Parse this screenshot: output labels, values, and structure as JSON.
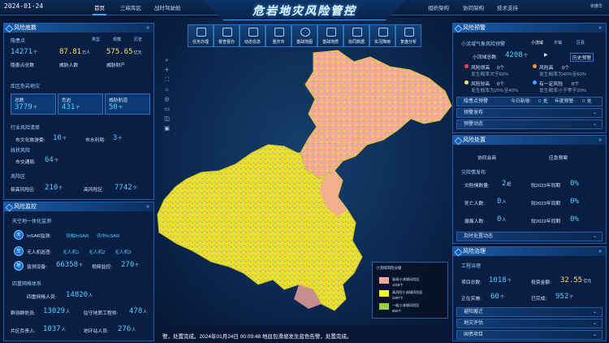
{
  "header": {
    "date": "2024-01-24",
    "title": "危岩地灾风险管控",
    "nav_left": [
      "首页",
      "三峡库区",
      "战时驾驶舱"
    ],
    "nav_right": [
      "组织架构",
      "协同架构",
      "技术支持"
    ],
    "user": "张珊华"
  },
  "toolbar": {
    "items": [
      "任务办理",
      "督查督办",
      "动态信息",
      "重庆市",
      "基础地图",
      "基础地质",
      "协同数据",
      "实况降雨",
      "复盘分析"
    ]
  },
  "left": {
    "risk_base": {
      "title": "风险底数",
      "hazard_label": "隐患点",
      "tabs": [
        "类型",
        "规模",
        "历史"
      ],
      "points": "14271",
      "points_unit": "个",
      "points_label": "隐患点总数",
      "pop": "87.81",
      "pop_unit": "万人",
      "pop_label": "威胁人数",
      "prop": "575.65",
      "prop_unit": "亿元",
      "prop_label": "威胁财产",
      "reservoir_title": "库区危岩地灾",
      "total_label": "总数",
      "total": "3779",
      "total_unit": "个",
      "danger_label": "危岩",
      "danger": "431",
      "danger_unit": "个",
      "route_label": "威胁航道",
      "route": "50",
      "route_unit": "个",
      "industry_title": "行业风险清单",
      "culture_label": "市文化旅游委:",
      "culture": "10",
      "culture_unit": "个",
      "water_label": "市水利局:",
      "water": "3",
      "water_unit": "个",
      "line_title": "线状风险",
      "traffic_label": "市交通局:",
      "traffic": "64",
      "traffic_unit": "个",
      "zone_title": "风险区",
      "ext_label": "极高风险区:",
      "ext": "210",
      "ext_unit": "个",
      "high_label": "高风险区:",
      "high": "7742",
      "high_unit": "个"
    },
    "monitor": {
      "title": "风险监控",
      "sky_title": "天空地一体化监测",
      "tag_sky": "天",
      "tag_air": "空",
      "tag_ground": "地",
      "insar": "InSAR监测:",
      "insar_a": "讯柏InSAR",
      "insar_b": "讯中InSAR",
      "uav": "无人机巡查:",
      "uav_a": "无人机1",
      "uav_b": "无人机2",
      "uav_c": "无人机3",
      "device_label": "监测设备:",
      "device": "66358",
      "device_unit": "个",
      "video_label": "视频监控:",
      "video": "270",
      "video_unit": "个",
      "grid_title": "四重网格体系",
      "grid4_label": "四重网格人员:",
      "grid4": "14820",
      "grid4_unit": "人",
      "mass_label": "群测群防员:",
      "mass": "13029",
      "mass_unit": "人",
      "eng_label": "驻守地质工程师:",
      "eng": "478",
      "eng_unit": "人",
      "area_label": "片区负责人:",
      "area": "1037",
      "area_unit": "人",
      "station_label": "地环站人员:",
      "station": "276",
      "station_unit": "人"
    }
  },
  "right": {
    "warn": {
      "title": "风险预警",
      "sub": "小流域气象风险预警",
      "tabs": [
        "小流域",
        "乡镇",
        "区县"
      ],
      "basin_label": "小流域总数:",
      "basin": "4208",
      "basin_unit": "个",
      "history": "历史预警",
      "r1a": "风险很高",
      "r1a_v": "0个",
      "r1a_d": "发生概率大于60%",
      "r1b": "风险高",
      "r1b_v": "0个",
      "r1b_d": "发生概率为40%至60%",
      "r2a": "风险较高",
      "r2a_v": "0个",
      "r2a_d": "发生概率为20%至40%",
      "r2b": "有一定风险",
      "r2b_v": "0个",
      "r2b_d": "发生概率小于等于20%",
      "hazard_warn": "隐患点预警",
      "today": "今日新增:",
      "today_v": "0",
      "today_u": "处",
      "year": "年度预警:",
      "year_v": "0",
      "year_u": "处",
      "release": "预警发布",
      "dynamic": "预警动态"
    },
    "handle": {
      "title": "风险处置",
      "coop": "协同会商",
      "plan": "应急预案",
      "event_title": "灾险情发布",
      "ev1": "灾险情数量:",
      "ev1_v": "2",
      "ev1_u": "起",
      "ev1_c": "较2023年同期",
      "ev1_p": "0%",
      "ev2": "死亡人数:",
      "ev2_v": "0",
      "ev2_u": "人",
      "ev2_c": "较2023年同期",
      "ev2_p": "0%",
      "ev3": "撤离人数:",
      "ev3_v": "0",
      "ev3_u": "人",
      "ev3_c": "较2023年同期",
      "ev3_p": "0%",
      "timely": "及时处置动态"
    },
    "govern": {
      "title": "风险治理",
      "proj_title": "工程治理",
      "proj_label": "项目总数:",
      "proj": "1018",
      "proj_unit": "个",
      "invest_label": "投资金额:",
      "invest": "32.55",
      "invest_unit": "亿元",
      "doing_label": "正在实施:",
      "doing": "60",
      "doing_unit": "个",
      "done_label": "已完成:",
      "done": "952",
      "done_unit": "个",
      "r1": "避险搬迁",
      "r2": "地灾评估",
      "r3": "国债项目"
    }
  },
  "map_legend": {
    "title": "小流域风险分级",
    "items": [
      {
        "label": "极高小流域风险区",
        "count": "1018个",
        "color": "#f4a6a0"
      },
      {
        "label": "高风险小流域风险区",
        "count": "2297个",
        "color": "#f7f72c"
      },
      {
        "label": "一般小流域风险区",
        "count": "893个",
        "color": "#9ccc45"
      }
    ]
  },
  "ticker": "警，处置完成。2024年01月24日 00:09:48 地皿包滑坡发生蓝色告警，处置完成。"
}
